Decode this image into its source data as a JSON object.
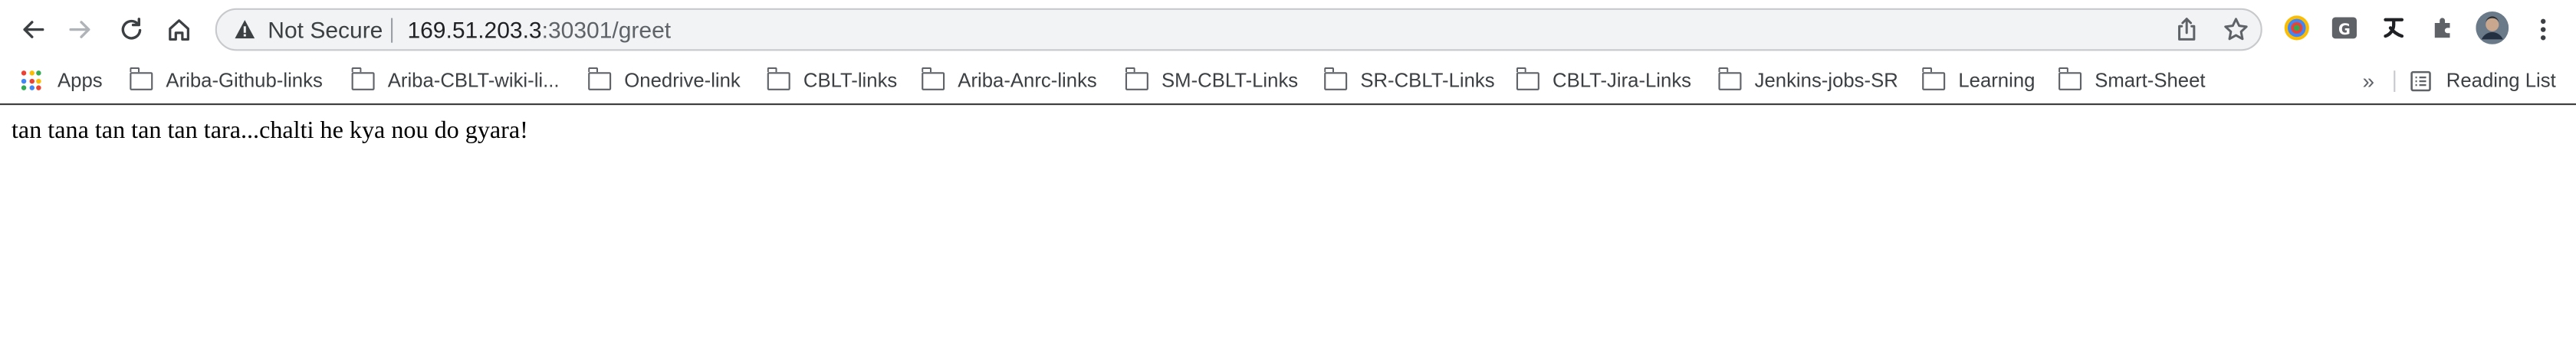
{
  "omnibox": {
    "security_label": "Not Secure",
    "url_host": "169.51.203.3",
    "url_rest": ":30301/greet"
  },
  "bookmarks": {
    "apps_label": "Apps",
    "items": [
      {
        "label": "Ariba-Github-links"
      },
      {
        "label": "Ariba-CBLT-wiki-li..."
      },
      {
        "label": "Onedrive-link"
      },
      {
        "label": "CBLT-links"
      },
      {
        "label": "Ariba-Anrc-links"
      },
      {
        "label": "SM-CBLT-Links"
      },
      {
        "label": "SR-CBLT-Links"
      },
      {
        "label": "CBLT-Jira-Links"
      },
      {
        "label": "Jenkins-jobs-SR"
      },
      {
        "label": "Learning"
      },
      {
        "label": "Smart-Sheet"
      }
    ],
    "overflow_label": "»",
    "reading_list_label": "Reading List"
  },
  "page": {
    "text": "tan tana tan tan tan tara...chalti he kya nou do gyara!"
  },
  "colors": {
    "apps_dots": [
      "#ea4335",
      "#fbbc04",
      "#34a853",
      "#4285f4",
      "#ea4335",
      "#fbbc04",
      "#34a853",
      "#4285f4",
      "#ea4335"
    ]
  }
}
